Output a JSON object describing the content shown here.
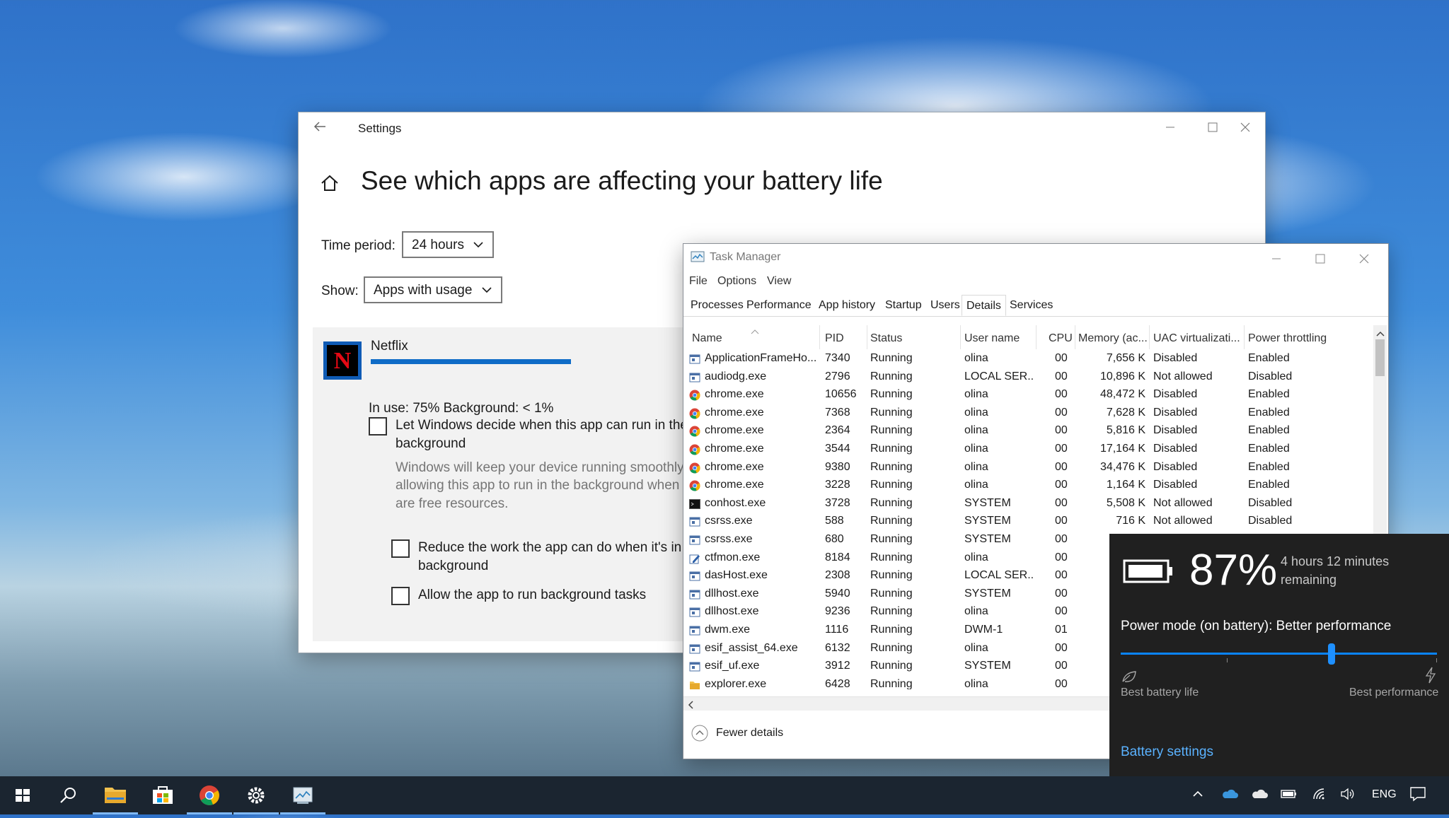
{
  "settings": {
    "window_title": "Settings",
    "heading": "See which apps are affecting your battery life",
    "time_period_label": "Time period:",
    "time_period_value": "24 hours",
    "show_label": "Show:",
    "show_value": "Apps with usage",
    "app": {
      "name": "Netflix",
      "usage_text": "In use: 75% Background: < 1%",
      "usage_fraction": 0.75,
      "let_windows_line1": "Let Windows decide when this app can run in the",
      "let_windows_line2": "background",
      "desc_line1": "Windows will keep your device running smoothly",
      "desc_line2": "allowing this app to run in the background when t",
      "desc_line3": "are free resources.",
      "reduce_line1": "Reduce the work the app can do when it's in t",
      "reduce_line2": "background",
      "allow_bg": "Allow the app to run background tasks"
    }
  },
  "taskmgr": {
    "title": "Task Manager",
    "menu": [
      "File",
      "Options",
      "View"
    ],
    "tabs": [
      "Processes",
      "Performance",
      "App history",
      "Startup",
      "Users",
      "Details",
      "Services"
    ],
    "active_tab": "Details",
    "columns": [
      "Name",
      "PID",
      "Status",
      "User name",
      "CPU",
      "Memory (ac...",
      "UAC virtualizati...",
      "Power throttling"
    ],
    "rows": [
      {
        "icon": "app-window-icon",
        "name": "ApplicationFrameHo...",
        "pid": "7340",
        "status": "Running",
        "user": "olina",
        "cpu": "00",
        "mem": "7,656 K",
        "uac": "Disabled",
        "power": "Enabled"
      },
      {
        "icon": "app-window-icon",
        "name": "audiodg.exe",
        "pid": "2796",
        "status": "Running",
        "user": "LOCAL SER...",
        "cpu": "00",
        "mem": "10,896 K",
        "uac": "Not allowed",
        "power": "Disabled"
      },
      {
        "icon": "chrome-icon",
        "name": "chrome.exe",
        "pid": "10656",
        "status": "Running",
        "user": "olina",
        "cpu": "00",
        "mem": "48,472 K",
        "uac": "Disabled",
        "power": "Enabled"
      },
      {
        "icon": "chrome-icon",
        "name": "chrome.exe",
        "pid": "7368",
        "status": "Running",
        "user": "olina",
        "cpu": "00",
        "mem": "7,628 K",
        "uac": "Disabled",
        "power": "Enabled"
      },
      {
        "icon": "chrome-icon",
        "name": "chrome.exe",
        "pid": "2364",
        "status": "Running",
        "user": "olina",
        "cpu": "00",
        "mem": "5,816 K",
        "uac": "Disabled",
        "power": "Enabled"
      },
      {
        "icon": "chrome-icon",
        "name": "chrome.exe",
        "pid": "3544",
        "status": "Running",
        "user": "olina",
        "cpu": "00",
        "mem": "17,164 K",
        "uac": "Disabled",
        "power": "Enabled"
      },
      {
        "icon": "chrome-icon",
        "name": "chrome.exe",
        "pid": "9380",
        "status": "Running",
        "user": "olina",
        "cpu": "00",
        "mem": "34,476 K",
        "uac": "Disabled",
        "power": "Enabled"
      },
      {
        "icon": "chrome-icon",
        "name": "chrome.exe",
        "pid": "3228",
        "status": "Running",
        "user": "olina",
        "cpu": "00",
        "mem": "1,164 K",
        "uac": "Disabled",
        "power": "Enabled"
      },
      {
        "icon": "console-icon",
        "name": "conhost.exe",
        "pid": "3728",
        "status": "Running",
        "user": "SYSTEM",
        "cpu": "00",
        "mem": "5,508 K",
        "uac": "Not allowed",
        "power": "Disabled"
      },
      {
        "icon": "app-window-icon",
        "name": "csrss.exe",
        "pid": "588",
        "status": "Running",
        "user": "SYSTEM",
        "cpu": "00",
        "mem": "716 K",
        "uac": "Not allowed",
        "power": "Disabled"
      },
      {
        "icon": "app-window-icon",
        "name": "csrss.exe",
        "pid": "680",
        "status": "Running",
        "user": "SYSTEM",
        "cpu": "00",
        "mem": "",
        "uac": "",
        "power": ""
      },
      {
        "icon": "pen-icon",
        "name": "ctfmon.exe",
        "pid": "8184",
        "status": "Running",
        "user": "olina",
        "cpu": "00",
        "mem": "",
        "uac": "",
        "power": ""
      },
      {
        "icon": "app-window-icon",
        "name": "dasHost.exe",
        "pid": "2308",
        "status": "Running",
        "user": "LOCAL SER...",
        "cpu": "00",
        "mem": "",
        "uac": "",
        "power": ""
      },
      {
        "icon": "app-window-icon",
        "name": "dllhost.exe",
        "pid": "5940",
        "status": "Running",
        "user": "SYSTEM",
        "cpu": "00",
        "mem": "",
        "uac": "",
        "power": ""
      },
      {
        "icon": "app-window-icon",
        "name": "dllhost.exe",
        "pid": "9236",
        "status": "Running",
        "user": "olina",
        "cpu": "00",
        "mem": "",
        "uac": "",
        "power": ""
      },
      {
        "icon": "app-window-icon",
        "name": "dwm.exe",
        "pid": "1116",
        "status": "Running",
        "user": "DWM-1",
        "cpu": "01",
        "mem": "",
        "uac": "",
        "power": ""
      },
      {
        "icon": "app-window-icon",
        "name": "esif_assist_64.exe",
        "pid": "6132",
        "status": "Running",
        "user": "olina",
        "cpu": "00",
        "mem": "",
        "uac": "",
        "power": ""
      },
      {
        "icon": "app-window-icon",
        "name": "esif_uf.exe",
        "pid": "3912",
        "status": "Running",
        "user": "SYSTEM",
        "cpu": "00",
        "mem": "",
        "uac": "",
        "power": ""
      },
      {
        "icon": "folder-icon",
        "name": "explorer.exe",
        "pid": "6428",
        "status": "Running",
        "user": "olina",
        "cpu": "00",
        "mem": "",
        "uac": "",
        "power": ""
      }
    ],
    "fewer_details": "Fewer details"
  },
  "battery": {
    "percent": "87%",
    "remaining_line1": "4 hours 12 minutes",
    "remaining_line2": "remaining",
    "power_mode": "Power mode (on battery): Better performance",
    "slider_fraction": 0.67,
    "left_label": "Best battery life",
    "right_label": "Best performance",
    "link": "Battery settings"
  },
  "taskbar": {
    "language": "ENG",
    "pinned": [
      "file-explorer-icon",
      "store-icon",
      "chrome-icon",
      "settings-icon",
      "task-manager-icon"
    ]
  },
  "colors": {
    "accent": "#0f6cc7",
    "flyout_bg": "#202020",
    "taskbar_bg": "#1b2530",
    "link_blue": "#5ab2ff"
  }
}
